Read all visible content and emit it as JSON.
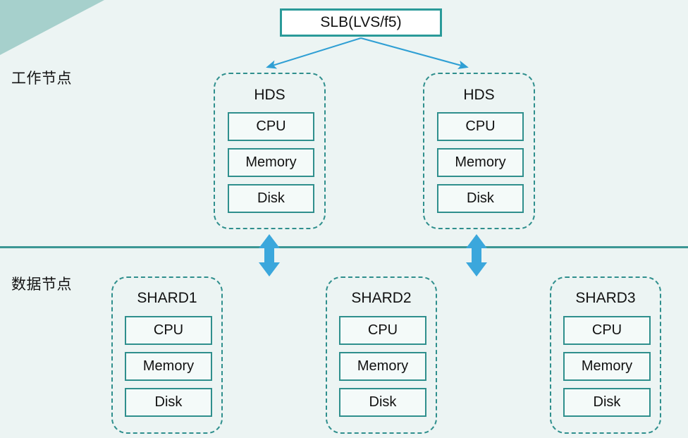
{
  "diagram": {
    "background_color": "#ecf4f3",
    "accent_teal": "#2f8f8d",
    "accent_blue": "#3ba7dc",
    "corner_wedge_color": "#a6d0cc",
    "tiers": {
      "work_label": "工作节点",
      "data_label": "数据节点"
    },
    "load_balancer": {
      "label": "SLB(LVS/f5)"
    },
    "resource_labels": {
      "cpu": "CPU",
      "memory": "Memory",
      "disk": "Disk"
    },
    "worker_nodes": [
      {
        "title": "HDS",
        "resources": [
          {
            "label": "CPU"
          },
          {
            "label": "Memory"
          },
          {
            "label": "Disk"
          }
        ]
      },
      {
        "title": "HDS",
        "resources": [
          {
            "label": "CPU"
          },
          {
            "label": "Memory"
          },
          {
            "label": "Disk"
          }
        ]
      }
    ],
    "data_nodes": [
      {
        "title": "SHARD1",
        "resources": [
          {
            "label": "CPU"
          },
          {
            "label": "Memory"
          },
          {
            "label": "Disk"
          }
        ]
      },
      {
        "title": "SHARD2",
        "resources": [
          {
            "label": "CPU"
          },
          {
            "label": "Memory"
          },
          {
            "label": "Disk"
          }
        ]
      },
      {
        "title": "SHARD3",
        "resources": [
          {
            "label": "CPU"
          },
          {
            "label": "Memory"
          },
          {
            "label": "Disk"
          }
        ]
      }
    ],
    "connections": [
      {
        "from": "SLB(LVS/f5)",
        "to": "HDS",
        "style": "single-arrow"
      },
      {
        "from": "SLB(LVS/f5)",
        "to": "HDS",
        "style": "single-arrow"
      },
      {
        "from": "HDS",
        "to": "SHARD",
        "style": "double-arrow"
      },
      {
        "from": "HDS",
        "to": "SHARD",
        "style": "double-arrow"
      }
    ]
  }
}
